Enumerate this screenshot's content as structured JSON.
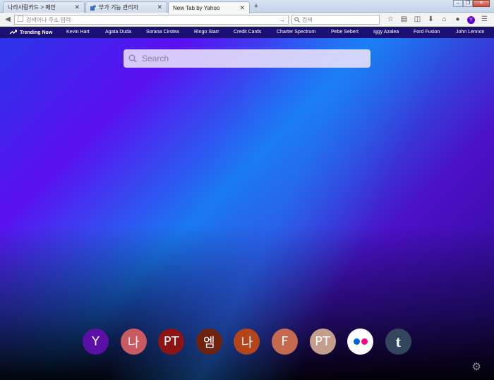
{
  "browser": {
    "tabs": [
      {
        "title": "나라사랑카드 > 메인",
        "active": false
      },
      {
        "title": "부가 기능 관리자",
        "active": false
      },
      {
        "title": "New Tab by Yahoo",
        "active": true
      }
    ],
    "url_placeholder": "검색어나 주소 입력",
    "search_placeholder": "검색"
  },
  "trending": {
    "heading": "Trending Now",
    "items": [
      "Kevin Hart",
      "Agata Duda",
      "Sorana Cirstea",
      "Ringo Starr",
      "Credit Cards",
      "Charter Spectrum",
      "Pebe Sebert",
      "Iggy Azalea",
      "Ford Fusion",
      "John Lennon"
    ]
  },
  "search": {
    "placeholder": "Search"
  },
  "shortcuts": [
    {
      "label": "Y",
      "color": "#5a0fa5",
      "icon": "yahoo-icon"
    },
    {
      "label": "나",
      "color": "#c85a62",
      "icon": "letter-icon"
    },
    {
      "label": "PT",
      "color": "#8c1414",
      "icon": "letter-icon"
    },
    {
      "label": "엠",
      "color": "#6e2210",
      "icon": "letter-icon"
    },
    {
      "label": "나",
      "color": "#b4451a",
      "icon": "letter-icon"
    },
    {
      "label": "F",
      "color": "#c56a50",
      "icon": "letter-icon"
    },
    {
      "label": "PT",
      "color": "#c39e8c",
      "icon": "letter-icon"
    },
    {
      "label": "",
      "color": "#ffffff",
      "icon": "flickr-icon"
    },
    {
      "label": "t",
      "color": "#34465d",
      "icon": "tumblr-icon"
    }
  ],
  "colors": {
    "trending_bar": "#1c0f73",
    "flickr_blue": "#0063dc",
    "flickr_pink": "#ff0084"
  }
}
